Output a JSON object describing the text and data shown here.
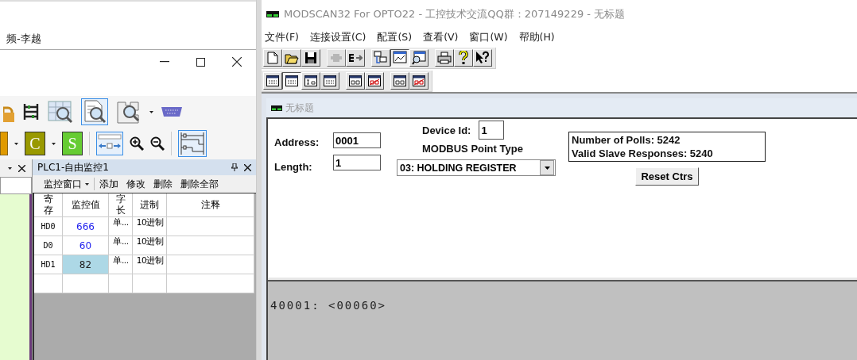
{
  "left_window": {
    "title": "频-李越",
    "letter_buttons": [
      {
        "letter": "C",
        "color": "#999900"
      },
      {
        "letter": "S",
        "color": "#66cc33"
      }
    ],
    "panel": {
      "title": "PLC1-自由监控1",
      "menu_button": "监控窗口",
      "actions": [
        "添加",
        "修改",
        "删除",
        "删除全部"
      ],
      "table": {
        "columns": [
          "寄存",
          "监控值",
          "字长",
          "进制",
          "注释"
        ],
        "rows": [
          {
            "register": "HD0",
            "value": "666",
            "word_length": "单...",
            "radix": "10进制",
            "selected": false
          },
          {
            "register": "D0",
            "value": "60",
            "word_length": "单...",
            "radix": "10进制",
            "selected": false
          },
          {
            "register": "HD1",
            "value": "82",
            "word_length": "单...",
            "radix": "10进制",
            "selected": true
          }
        ]
      }
    }
  },
  "app": {
    "title": "MODSCAN32 For OPTO22 - 工控技术交流QQ群：207149229 - 无标题",
    "menu": [
      "文件(F)",
      "连接设置(C)",
      "配置(S)",
      "查看(V)",
      "窗口(W)",
      "帮助(H)"
    ],
    "toolbar": [
      [
        {
          "kind": "new",
          "selected": false,
          "disabled": false
        },
        {
          "kind": "open",
          "selected": false,
          "disabled": false
        },
        {
          "kind": "save",
          "selected": false,
          "disabled": false
        }
      ],
      [
        {
          "kind": "connect",
          "selected": false,
          "disabled": true
        },
        {
          "kind": "disconnect",
          "selected": false,
          "disabled": false
        }
      ],
      [
        {
          "kind": "setup",
          "selected": false,
          "disabled": false
        },
        {
          "kind": "display",
          "selected": true,
          "disabled": false
        },
        {
          "kind": "monitor",
          "selected": false,
          "disabled": false
        }
      ],
      [
        {
          "kind": "print",
          "selected": false,
          "disabled": false
        },
        {
          "kind": "help",
          "selected": false,
          "disabled": false
        },
        {
          "kind": "context-help",
          "selected": false,
          "disabled": false
        }
      ]
    ],
    "format_toolbar": [
      [
        {
          "kind": "binary",
          "selected": false
        },
        {
          "kind": "decimal",
          "selected": true
        },
        {
          "kind": "integer",
          "selected": false
        },
        {
          "kind": "hex",
          "selected": false
        }
      ],
      [
        {
          "kind": "float",
          "selected": false
        },
        {
          "kind": "float-swapped",
          "selected": false
        }
      ],
      [
        {
          "kind": "double",
          "selected": false
        },
        {
          "kind": "double-swapped",
          "selected": false
        }
      ]
    ],
    "document": {
      "title": "无标题",
      "address_label": "Address:",
      "address": "0001",
      "length_label": "Length:",
      "length": "1",
      "device_id_label": "Device Id:",
      "device_id": "1",
      "point_type_label": "MODBUS Point Type",
      "point_type": "03: HOLDING REGISTER",
      "stats": [
        "Number of Polls: 5242",
        "Valid Slave Responses: 5240"
      ],
      "reset_button": "Reset Ctrs",
      "data_lines": [
        "40001: <00060>"
      ]
    }
  }
}
